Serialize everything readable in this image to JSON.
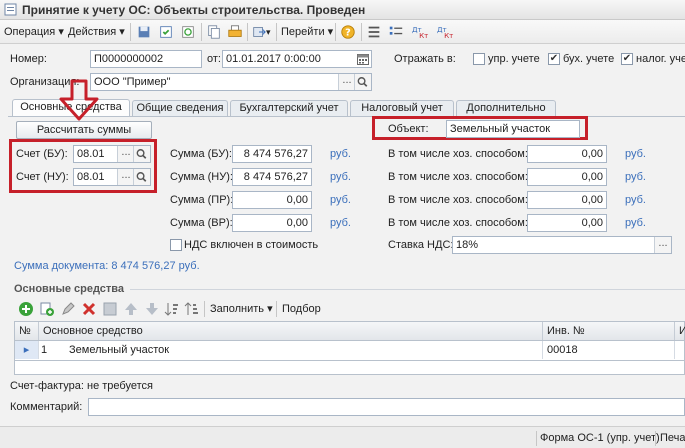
{
  "window": {
    "title": "Принятие к учету ОС: Объекты строительства. Проведен"
  },
  "toolbar": {
    "operation_label": "Операция",
    "actions_label": "Действия",
    "goto_label": "Перейти",
    "help_label": "?",
    "dt_kt_label": "Дт Кт"
  },
  "header": {
    "number_label": "Номер:",
    "number_value": "П0000000002",
    "date_label": "от:",
    "date_value": "01.01.2017 0:00:00",
    "reflect_label": "Отражать в:",
    "upr_label": "упр. учете",
    "upr_checked": false,
    "buh_label": "бух. учете",
    "buh_checked": true,
    "nalog_label": "налог. учете",
    "nalog_checked": true,
    "org_label": "Организация:",
    "org_value": "ООО \"Пример\""
  },
  "tabs": [
    {
      "label": "Основные средства",
      "active": true
    },
    {
      "label": "Общие сведения",
      "active": false
    },
    {
      "label": "Бухгалтерский учет",
      "active": false
    },
    {
      "label": "Налоговый учет",
      "active": false
    },
    {
      "label": "Дополнительно",
      "active": false
    }
  ],
  "main": {
    "calc_button": "Рассчитать суммы",
    "object_label": "Объект:",
    "object_value": "Земельный участок",
    "account_bu_label": "Счет (БУ):",
    "account_bu_value": "08.01",
    "account_nu_label": "Счет (НУ):",
    "account_nu_value": "08.01",
    "sum_bu_label": "Сумма (БУ):",
    "sum_bu_value": "8 474 576,27",
    "sum_nu_label": "Сумма (НУ):",
    "sum_nu_value": "8 474 576,27",
    "sum_pr_label": "Сумма (ПР):",
    "sum_pr_value": "0,00",
    "sum_vr_label": "Сумма (ВР):",
    "sum_vr_value": "0,00",
    "currency": "руб.",
    "hoz_label": "В том числе хоз. способом:",
    "hoz_values": [
      "0,00",
      "0,00",
      "0,00",
      "0,00"
    ],
    "nds_included_label": "НДС включен в стоимость",
    "nds_included_checked": false,
    "nds_rate_label": "Ставка НДС:",
    "nds_rate_value": "18%",
    "doc_sum_text": "Сумма документа: 8 474 576,27 руб."
  },
  "assets": {
    "section_title": "Основные средства",
    "fill_label": "Заполнить",
    "select_label": "Подбор",
    "columns": [
      "№",
      "Основное средство",
      "Инв. №",
      "Инв"
    ],
    "rows": [
      {
        "n": "1",
        "asset": "Земельный участок",
        "inv": "00018",
        "inv2": ""
      }
    ]
  },
  "footer": {
    "invoice_text": "Счет-фактура: не требуется",
    "comment_label": "Комментарий:",
    "comment_value": "",
    "form_label": "Форма ОС-1 (упр. учет)",
    "print_label": "Печа"
  },
  "colors": {
    "highlight": "#c6202a",
    "link": "#3b6fbb",
    "accent_green": "#3aa23a"
  }
}
